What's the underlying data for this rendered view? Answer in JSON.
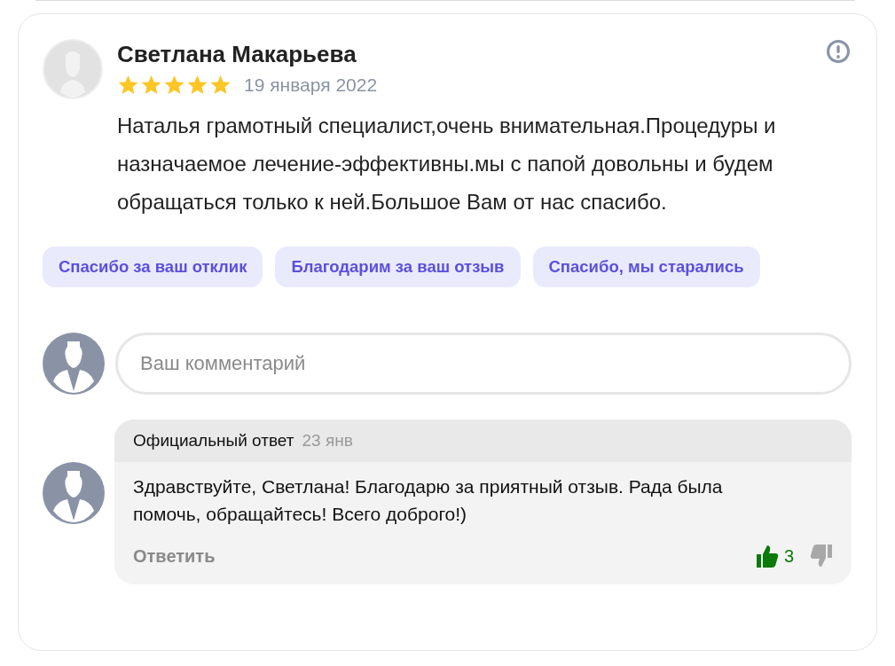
{
  "review": {
    "author": "Светлана Макарьева",
    "stars": 5,
    "date": "19 января 2022",
    "text": "Наталья грамотный специалист,очень внимательная.Процедуры и назначаемое лечение-эффективны.мы с папой довольны и будем обращаться только к ней.Большое Вам от нас спасибо."
  },
  "quick_replies": [
    "Спасибо за ваш отклик",
    "Благодарим за ваш отзыв",
    "Спасибо, мы старались"
  ],
  "comment_field": {
    "placeholder": "Ваш комментарий"
  },
  "official_reply": {
    "label": "Официальный ответ",
    "date": "23 янв",
    "text": "Здравствуйте, Светлана! Благодарю за приятный отзыв. Рада была помочь, обращайтесь! Всего доброго!)",
    "reply_link": "Ответить",
    "likes": "3",
    "liked": true,
    "disliked": false
  }
}
